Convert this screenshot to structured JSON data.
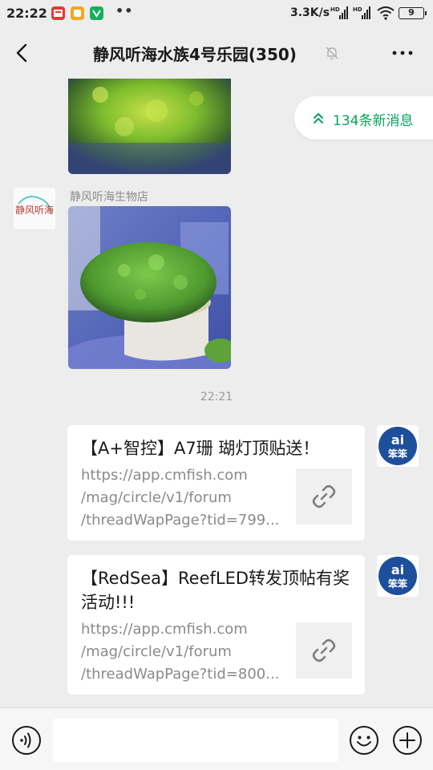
{
  "status_bar": {
    "time": "22:22",
    "dots": "••",
    "net_speed": "3.3K/s",
    "signal_label": "HD",
    "battery": "9"
  },
  "header": {
    "title": "静风听海水族4号乐园(350)"
  },
  "new_messages": {
    "label": "134条新消息"
  },
  "messages": {
    "sender_name": "静风听海生物店",
    "avatar_text": "静风听海",
    "time": "22:21",
    "bot_avatar_text_top": "ai",
    "bot_avatar_text_bottom": "笨笨"
  },
  "cards": [
    {
      "title": "【A+智控】A7珊 瑚灯顶贴送！",
      "desc_lines": [
        "https://app.cmfish.com",
        "/mag/circle/v1/forum",
        "/threadWapPage?tid=799..."
      ]
    },
    {
      "title": "【RedSea】ReefLED转发顶帖有奖活动!!!",
      "desc_lines": [
        "https://app.cmfish.com",
        "/mag/circle/v1/forum",
        "/threadWapPage?tid=800..."
      ]
    }
  ],
  "input": {
    "placeholder": ""
  },
  "colors": {
    "accent_green": "#07a35a",
    "background": "#ededed",
    "bot_avatar": "#1d4f9a"
  }
}
